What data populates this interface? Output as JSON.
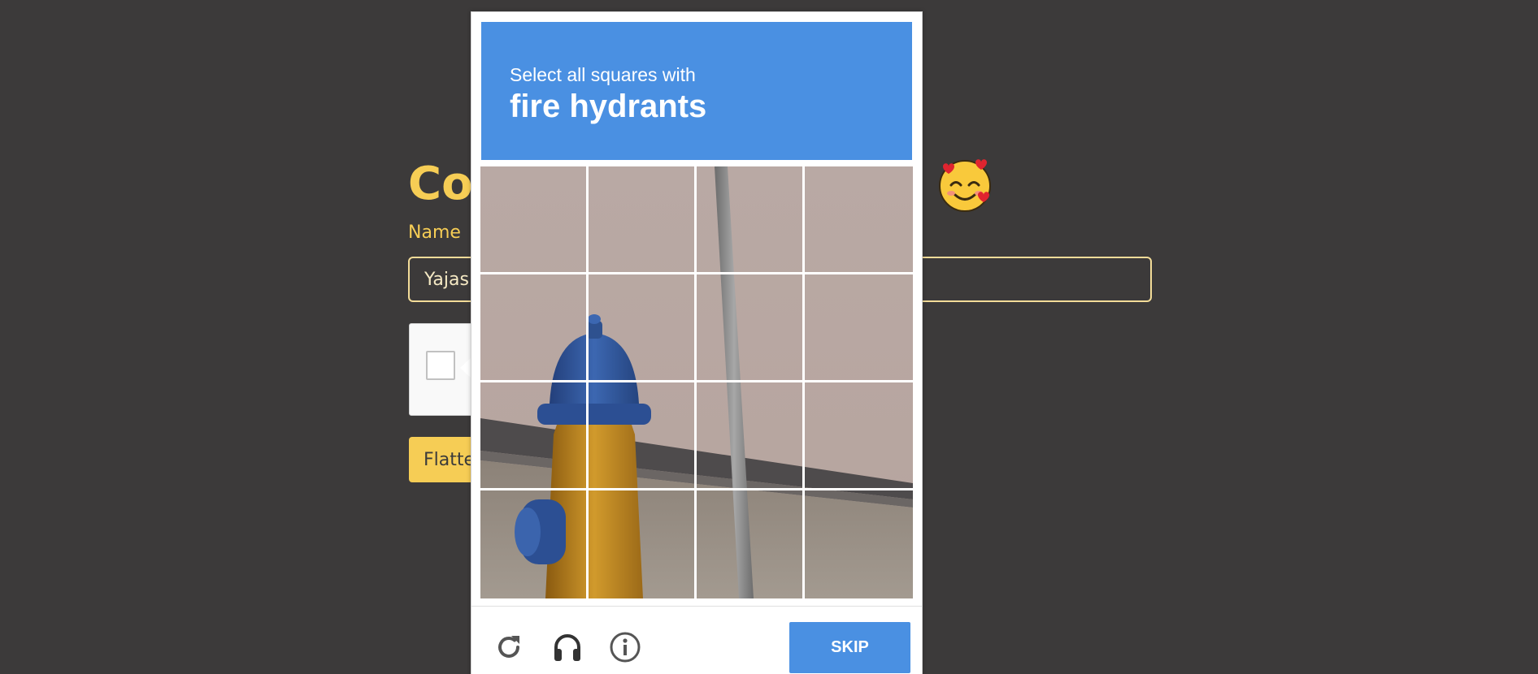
{
  "form": {
    "title": "Co",
    "name_label": "Name",
    "name_value": "Yajas",
    "submit_label": "Flatte"
  },
  "emoji": "smiling-face-with-hearts-icon",
  "challenge": {
    "instruction": "Select all squares with",
    "target": "fire hydrants",
    "grid_rows": 4,
    "grid_cols": 4,
    "skip_label": "SKIP",
    "icons": [
      "reload-icon",
      "audio-headphones-icon",
      "info-icon"
    ]
  },
  "colors": {
    "page_bg": "#3c3a3a",
    "accent_yellow": "#f6cd55",
    "challenge_blue": "#4a90e2"
  }
}
